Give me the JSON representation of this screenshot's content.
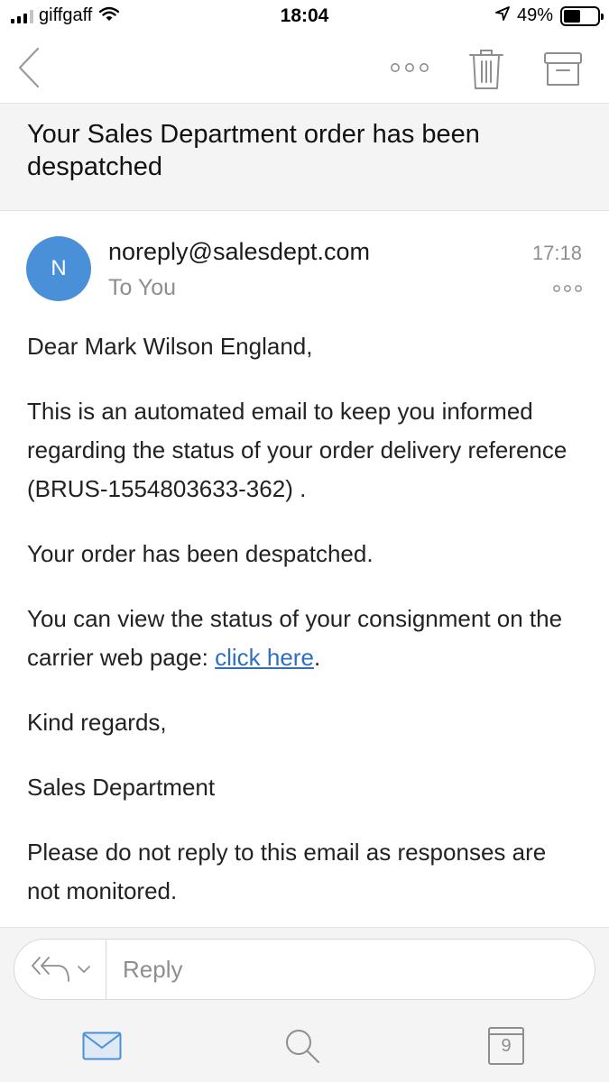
{
  "status_bar": {
    "carrier": "giffgaff",
    "time": "18:04",
    "battery_percent": "49%",
    "battery_level": 0.49,
    "icons": [
      "signal-icon",
      "wifi-icon",
      "location-icon",
      "battery-icon"
    ]
  },
  "toolbar": {
    "icons": [
      "back-chevron-icon",
      "more-icon",
      "trash-icon",
      "archive-icon"
    ]
  },
  "email": {
    "subject": "Your Sales Department order has been despatched",
    "avatar_initial": "N",
    "avatar_color": "#4a90d9",
    "sender": "noreply@salesdept.com",
    "recipients": "To You",
    "time": "17:18",
    "body": {
      "greeting": "Dear Mark Wilson England,",
      "intro": "This is an automated email to keep you informed regarding the status of your order delivery reference (BRUS-1554803633-362) .",
      "despatched": "Your order has been despatched.",
      "view_status_prefix": "You can view the status of your consignment on the carrier web page: ",
      "link_text": "click here",
      "view_status_suffix": ".",
      "sign_off": "Kind regards,",
      "signature": "Sales Department",
      "footer": "Please do not reply to this email as responses are not monitored."
    },
    "link_color": "#2f6fbf"
  },
  "reply_bar": {
    "placeholder": "Reply",
    "icons": [
      "reply-all-icon",
      "chevron-down-icon"
    ]
  },
  "tab_bar": {
    "calendar_day": "9",
    "accent_color": "#4a90d9",
    "icons": [
      "mail-icon",
      "search-icon",
      "calendar-icon"
    ]
  }
}
